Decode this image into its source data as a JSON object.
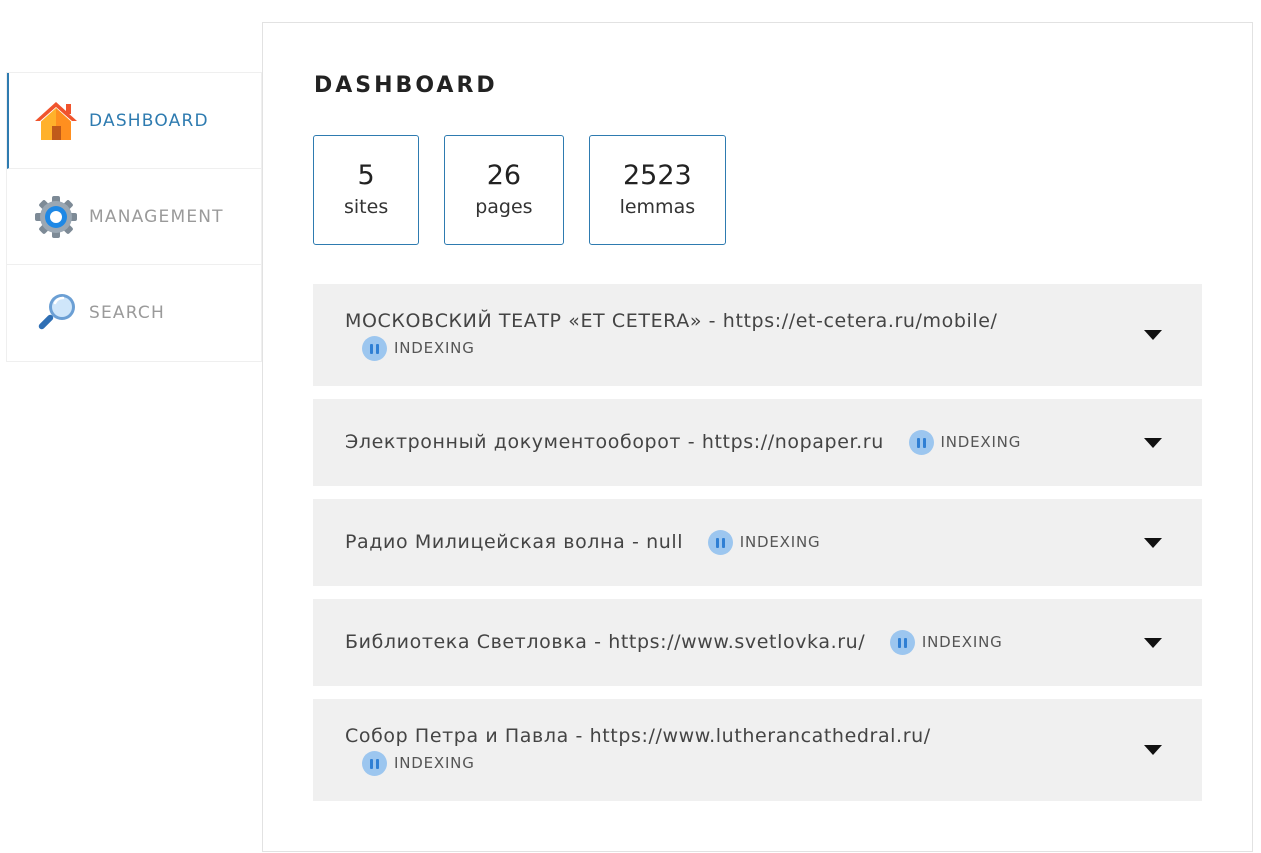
{
  "sidebar": {
    "items": [
      {
        "label": "DASHBOARD",
        "icon": "home-icon",
        "active": true
      },
      {
        "label": "MANAGEMENT",
        "icon": "gear-icon",
        "active": false
      },
      {
        "label": "SEARCH",
        "icon": "magnifier-icon",
        "active": false
      }
    ]
  },
  "main": {
    "title": "DASHBOARD",
    "stats": [
      {
        "value": "5",
        "label": "sites"
      },
      {
        "value": "26",
        "label": "pages"
      },
      {
        "value": "2523",
        "label": "lemmas"
      }
    ],
    "sites": [
      {
        "name": "МОСКОВСКИЙ ТЕАТР «ET CETERA»",
        "sep": " - ",
        "url": "https://et-cetera.ru/mobile/",
        "status": "INDEXING",
        "status_icon": "pause-icon"
      },
      {
        "name": "Электронный документооборот",
        "sep": " - ",
        "url": "https://nopaper.ru",
        "status": "INDEXING",
        "status_icon": "pause-icon"
      },
      {
        "name": "Радио Милицейская волна",
        "sep": " - ",
        "url": "null",
        "status": "INDEXING",
        "status_icon": "pause-icon"
      },
      {
        "name": "Библиотека Светловка",
        "sep": " - ",
        "url": "https://www.svetlovka.ru/",
        "status": "INDEXING",
        "status_icon": "pause-icon"
      },
      {
        "name": "Собор Петра и Павла",
        "sep": " - ",
        "url": "https://www.lutherancathedral.ru/",
        "status": "INDEXING",
        "status_icon": "pause-icon"
      }
    ]
  },
  "colors": {
    "accent": "#2e7bb0",
    "row_background": "#f0f0f0",
    "status_icon_fill": "#9cc6ef",
    "status_icon_bars": "#2f7fd4"
  }
}
